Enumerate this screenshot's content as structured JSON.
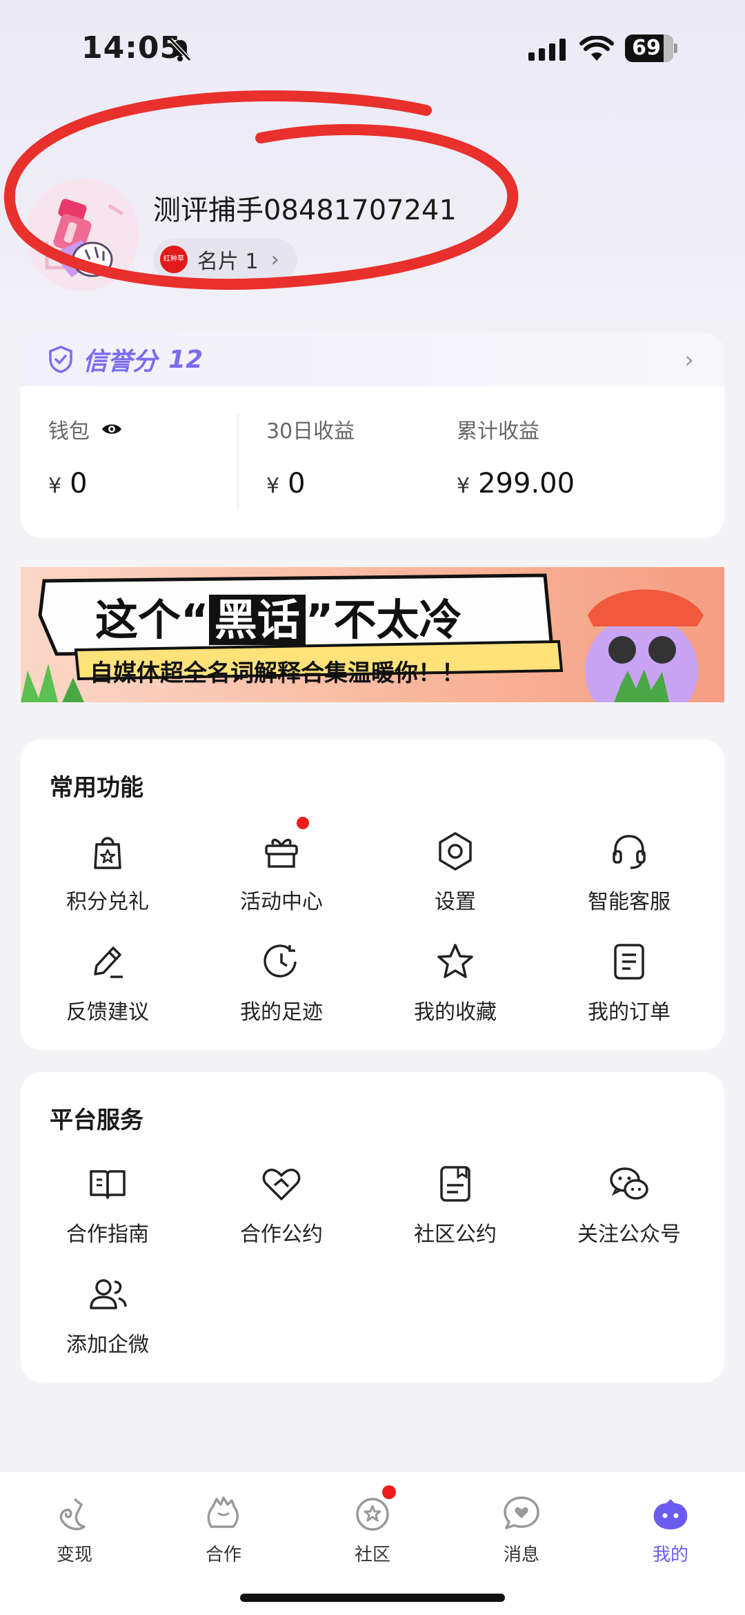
{
  "status_bar": {
    "time": "14:05",
    "battery": "69"
  },
  "profile": {
    "username": "测评捕手08481707241",
    "card_chip": {
      "logo_text": "红种草",
      "label": "名片 1"
    }
  },
  "credit": {
    "label": "信誉分",
    "score": "12"
  },
  "wallet": {
    "currency": "¥",
    "columns": [
      {
        "label": "钱包",
        "value": "0"
      },
      {
        "label": "30日收益",
        "value": "0"
      },
      {
        "label": "累计收益",
        "value": "299.00"
      }
    ]
  },
  "banner": {
    "headline_pre": "这个“",
    "headline_key": "黑话",
    "headline_post": "”不太冷",
    "subline": "自媒体超全名词解释合集温暖你！！"
  },
  "common_functions": {
    "title": "常用功能",
    "items": [
      {
        "label": "积分兑礼",
        "icon": "gift-bag-icon"
      },
      {
        "label": "活动中心",
        "icon": "gift-box-icon",
        "badge": true
      },
      {
        "label": "设置",
        "icon": "settings-hex-icon"
      },
      {
        "label": "智能客服",
        "icon": "headset-icon"
      },
      {
        "label": "反馈建议",
        "icon": "pencil-icon"
      },
      {
        "label": "我的足迹",
        "icon": "history-clock-icon"
      },
      {
        "label": "我的收藏",
        "icon": "star-icon"
      },
      {
        "label": "我的订单",
        "icon": "order-list-icon"
      }
    ]
  },
  "platform_services": {
    "title": "平台服务",
    "items": [
      {
        "label": "合作指南",
        "icon": "guide-book-icon"
      },
      {
        "label": "合作公约",
        "icon": "handshake-heart-icon"
      },
      {
        "label": "社区公约",
        "icon": "document-icon"
      },
      {
        "label": "关注公众号",
        "icon": "wechat-icon"
      },
      {
        "label": "添加企微",
        "icon": "contacts-icon"
      }
    ]
  },
  "tabbar": {
    "tabs": [
      {
        "label": "变现",
        "icon": "monetize-icon"
      },
      {
        "label": "合作",
        "icon": "cooperate-icon"
      },
      {
        "label": "社区",
        "icon": "community-icon",
        "badge": true
      },
      {
        "label": "消息",
        "icon": "message-icon"
      },
      {
        "label": "我的",
        "icon": "me-icon",
        "active": true
      }
    ]
  },
  "colors": {
    "accent": "#6b5cf0",
    "badge": "#f01c1c",
    "annotation": "#e8302c"
  }
}
